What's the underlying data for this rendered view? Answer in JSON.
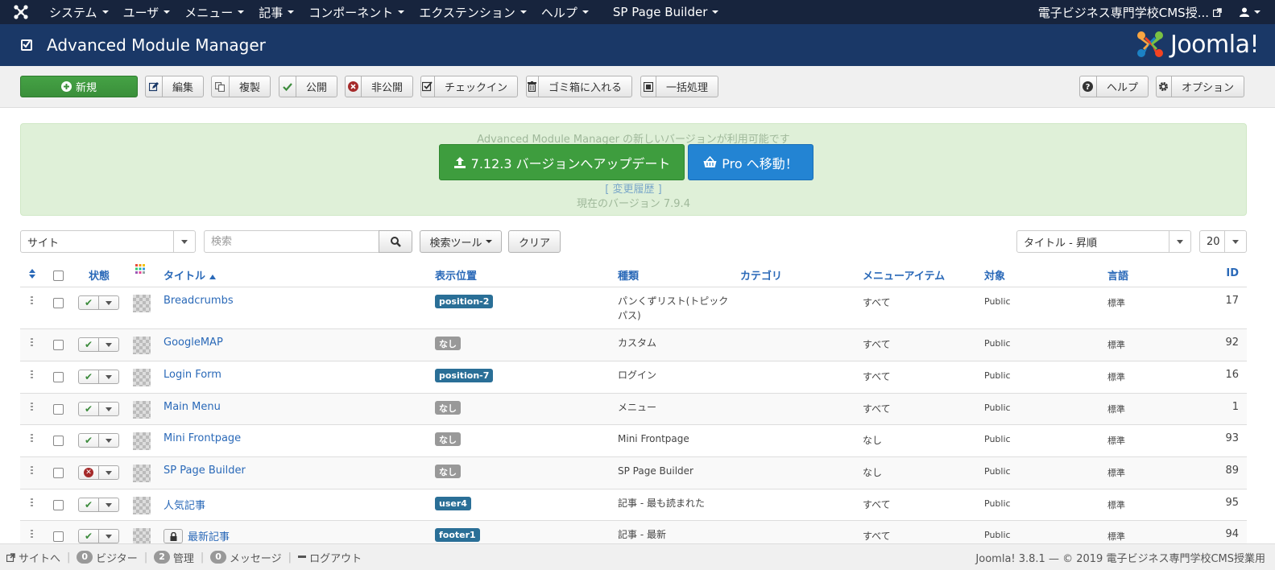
{
  "navbar": {
    "menus": [
      "システム",
      "ユーザ",
      "メニュー",
      "記事",
      "コンポーネント",
      "エクステンション",
      "ヘルプ",
      "SP Page Builder"
    ],
    "site_name": "電子ビジネス専門学校CMS授..."
  },
  "header": {
    "title": "Advanced Module Manager",
    "brand": "Joomla!"
  },
  "toolbar": {
    "new": "新規",
    "edit": "編集",
    "copy": "複製",
    "publish": "公開",
    "unpublish": "非公開",
    "checkin": "チェックイン",
    "trash": "ゴミ箱に入れる",
    "batch": "一括処理",
    "help": "ヘルプ",
    "options": "オプション"
  },
  "alert": {
    "message": "Advanced Module Manager の新しいバージョンが利用可能です",
    "update_button": "7.12.3 バージョンへアップデート",
    "pro_button": "Pro へ移動！",
    "changelog": "[ 変更履歴 ]",
    "current_version": "現在のバージョン 7.9.4"
  },
  "filters": {
    "client": "サイト",
    "search_placeholder": "検索",
    "search_tools": "検索ツール",
    "clear": "クリア",
    "ordering": "タイトル - 昇順",
    "limit": "20"
  },
  "table": {
    "headers": {
      "status": "状態",
      "title": "タイトル",
      "position": "表示位置",
      "type": "種類",
      "category": "カテゴリ",
      "menu_item": "メニューアイテム",
      "access": "対象",
      "language": "言語",
      "id": "ID"
    },
    "rows": [
      {
        "title": "Breadcrumbs",
        "position": "position-2",
        "position_style": "blue",
        "type": "パンくずリスト(トピックパス)",
        "menu": "すべて",
        "access": "Public",
        "lang": "標準",
        "id": "17",
        "published": true,
        "locked": false
      },
      {
        "title": "GoogleMAP",
        "position": "なし",
        "position_style": "gray",
        "type": "カスタム",
        "menu": "すべて",
        "access": "Public",
        "lang": "標準",
        "id": "92",
        "published": true,
        "locked": false
      },
      {
        "title": "Login Form",
        "position": "position-7",
        "position_style": "blue",
        "type": "ログイン",
        "menu": "すべて",
        "access": "Public",
        "lang": "標準",
        "id": "16",
        "published": true,
        "locked": false
      },
      {
        "title": "Main Menu",
        "position": "なし",
        "position_style": "gray",
        "type": "メニュー",
        "menu": "すべて",
        "access": "Public",
        "lang": "標準",
        "id": "1",
        "published": true,
        "locked": false
      },
      {
        "title": "Mini Frontpage",
        "position": "なし",
        "position_style": "gray",
        "type": "Mini Frontpage",
        "menu": "なし",
        "access": "Public",
        "lang": "標準",
        "id": "93",
        "published": true,
        "locked": false
      },
      {
        "title": "SP Page Builder",
        "position": "なし",
        "position_style": "gray",
        "type": "SP Page Builder",
        "menu": "なし",
        "access": "Public",
        "lang": "標準",
        "id": "89",
        "published": false,
        "locked": false
      },
      {
        "title": "人気記事",
        "position": "user4",
        "position_style": "blue",
        "type": "記事 - 最も読まれた",
        "menu": "すべて",
        "access": "Public",
        "lang": "標準",
        "id": "95",
        "published": true,
        "locked": false
      },
      {
        "title": "最新記事",
        "position": "footer1",
        "position_style": "blue",
        "type": "記事 - 最新",
        "menu": "すべて",
        "access": "Public",
        "lang": "標準",
        "id": "94",
        "published": true,
        "locked": true
      }
    ]
  },
  "footer": {
    "view_site": "サイトへ",
    "visitors_count": "0",
    "visitors": "ビジター",
    "admins_count": "2",
    "admins": "管理",
    "messages_count": "0",
    "messages": "メッセージ",
    "logout": "ログアウト",
    "copyright": "Joomla! 3.8.1 — © 2019 電子ビジネス専門学校CMS授業用"
  }
}
